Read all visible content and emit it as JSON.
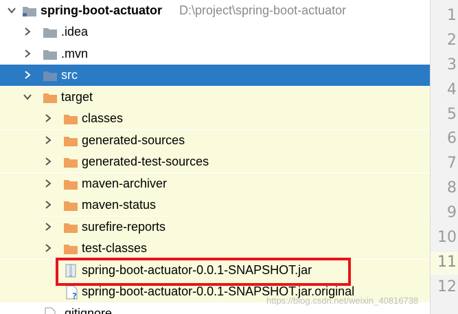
{
  "project": {
    "name": "spring-boot-actuator",
    "path": "D:\\project\\spring-boot-actuator"
  },
  "tree": {
    "idea": ".idea",
    "mvn": ".mvn",
    "src": "src",
    "target": "target",
    "classes": "classes",
    "generated_sources": "generated-sources",
    "generated_test_sources": "generated-test-sources",
    "maven_archiver": "maven-archiver",
    "maven_status": "maven-status",
    "surefire_reports": "surefire-reports",
    "test_classes": "test-classes",
    "jar": "spring-boot-actuator-0.0.1-SNAPSHOT.jar",
    "jar_original": "spring-boot-actuator-0.0.1-SNAPSHOT.jar.original",
    "gitignore": ".gitignore"
  },
  "gutter": {
    "lines": [
      "1",
      "2",
      "3",
      "4",
      "5",
      "6",
      "7",
      "8",
      "9",
      "10",
      "11",
      "12"
    ]
  },
  "watermark": "https://blog.csdn.net/weixin_40816738",
  "colors": {
    "selection": "#2b7bc4",
    "highlight_row": "#fafadc",
    "folder_orange": "#f0a15c",
    "folder_grey": "#9aa7b0",
    "annotation_red": "#e8141b"
  }
}
